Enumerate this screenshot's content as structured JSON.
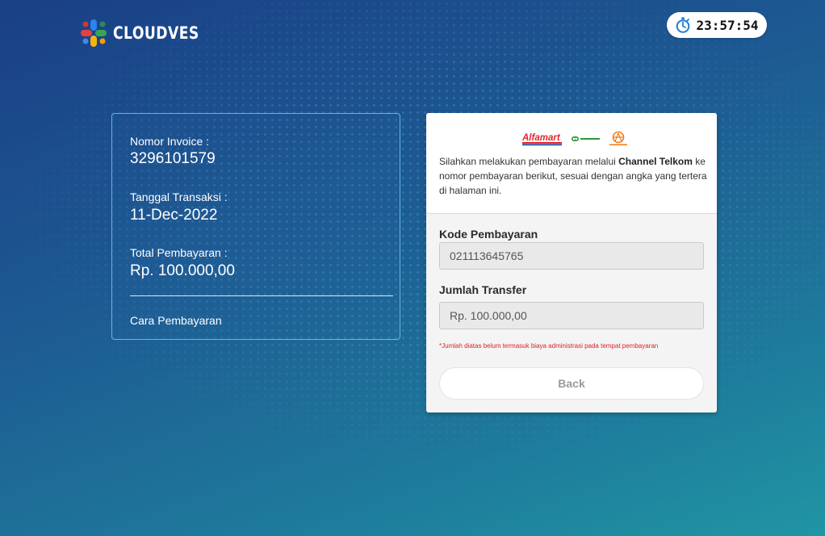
{
  "brand": {
    "name": "CLOUDVES",
    "logo_icon": "cloudves-logo-icon"
  },
  "timer": {
    "icon": "stopwatch-icon",
    "value": "23:57:54"
  },
  "invoice": {
    "invoice_label": "Nomor Invoice :",
    "invoice_value": "3296101579",
    "date_label": "Tanggal Transaksi :",
    "date_value": "11-Dec-2022",
    "total_label": "Total Pembayaran :",
    "total_value": "Rp. 100.000,00",
    "how_to_pay": "Cara Pembayaran"
  },
  "payment": {
    "partner_logos": {
      "alfamart": "Alfamart",
      "pegadaian": "Pegadaian",
      "pos": "POS INDONESIA"
    },
    "instruction_before": "Silahkan melakukan pembayaran melalui ",
    "instruction_channel": "Channel Telkom",
    "instruction_after": " ke nomor pembayaran berikut, sesuai dengan angka yang tertera di halaman ini.",
    "code_label": "Kode Pembayaran",
    "code_value": "021113645765",
    "amount_label": "Jumlah Transfer",
    "amount_value": "Rp. 100.000,00",
    "note": "*Jumlah diatas belum termasuk biaya administrasi pada tempat pembayaran",
    "back_label": "Back"
  },
  "colors": {
    "background_start": "#1a3f86",
    "background_end": "#2095a3",
    "panel_border": "#6ec8f5",
    "note_red": "#e02020",
    "alfamart_red": "#e3232c",
    "alfamart_blue": "#0a4a9a",
    "pegadaian_green": "#2c9a3c"
  }
}
